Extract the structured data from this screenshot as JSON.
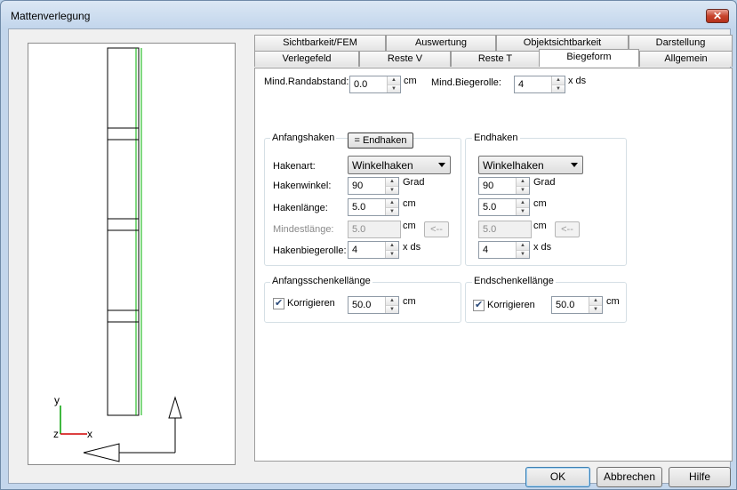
{
  "window": {
    "title": "Mattenverlegung",
    "close_glyph": "✕"
  },
  "preview": {
    "axis_y": "y",
    "axis_x": "x",
    "axis_z": "z"
  },
  "tabs_row1": [
    {
      "label": "Sichtbarkeit/FEM"
    },
    {
      "label": "Auswertung"
    },
    {
      "label": "Objektsichtbarkeit"
    },
    {
      "label": "Darstellung"
    }
  ],
  "tabs_row2": [
    {
      "label": "Verlegefeld"
    },
    {
      "label": "Reste V"
    },
    {
      "label": "Reste T"
    },
    {
      "label": "Biegeform",
      "active": true
    },
    {
      "label": "Allgemein"
    }
  ],
  "top": {
    "randabstand_label": "Mind.Randabstand:",
    "randabstand_value": "0.0",
    "randabstand_unit": "cm",
    "biegerolle_label": "Mind.Biegerolle:",
    "biegerolle_value": "4",
    "biegerolle_unit": "x ds"
  },
  "anfangshaken": {
    "title": "Anfangshaken",
    "copy_button": "= Endhaken",
    "hakenart_label": "Hakenart:",
    "hakenart_value": "Winkelhaken",
    "hakenwinkel_label": "Hakenwinkel:",
    "hakenwinkel_value": "90",
    "hakenwinkel_unit": "Grad",
    "hakenlaenge_label": "Hakenlänge:",
    "hakenlaenge_value": "5.0",
    "hakenlaenge_unit": "cm",
    "mindestlaenge_label": "Mindestlänge:",
    "mindestlaenge_value": "5.0",
    "mindestlaenge_unit": "cm",
    "mindestlaenge_button": "<--",
    "biegerolle_label": "Hakenbiegerolle:",
    "biegerolle_value": "4",
    "biegerolle_unit": "x ds"
  },
  "endhaken": {
    "title": "Endhaken",
    "hakenart_value": "Winkelhaken",
    "hakenwinkel_value": "90",
    "hakenwinkel_unit": "Grad",
    "hakenlaenge_value": "5.0",
    "hakenlaenge_unit": "cm",
    "mindestlaenge_value": "5.0",
    "mindestlaenge_unit": "cm",
    "mindestlaenge_button": "<--",
    "biegerolle_value": "4",
    "biegerolle_unit": "x ds"
  },
  "anfangsschenkel": {
    "title": "Anfangsschenkellänge",
    "checkbox_label": "Korrigieren",
    "checked": true,
    "value": "50.0",
    "unit": "cm"
  },
  "endschenkel": {
    "title": "Endschenkellänge",
    "checkbox_label": "Korrigieren",
    "checked": true,
    "value": "50.0",
    "unit": "cm"
  },
  "buttons": {
    "ok": "OK",
    "cancel": "Abbrechen",
    "help": "Hilfe"
  }
}
